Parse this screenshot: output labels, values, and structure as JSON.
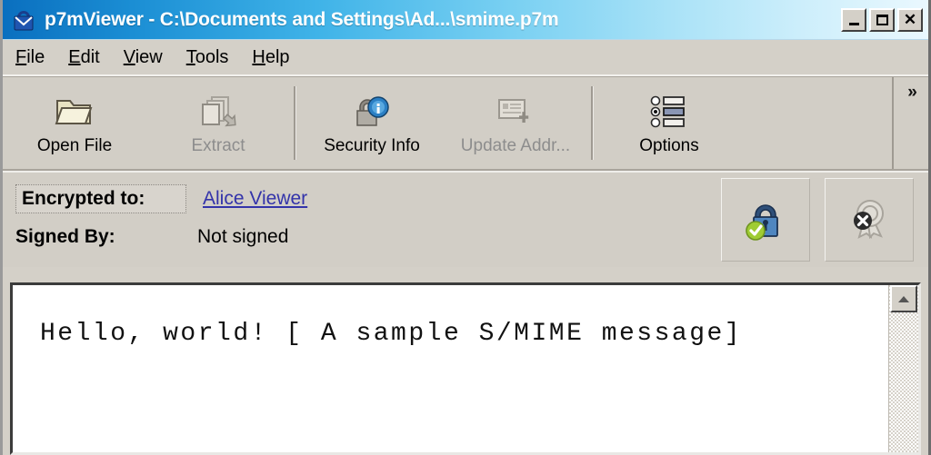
{
  "window": {
    "title": "p7mViewer - C:\\Documents and Settings\\Ad...\\smime.p7m",
    "app_icon": "envelope-lock-icon",
    "controls": {
      "minimize": "_",
      "maximize": "□",
      "close": "✕"
    }
  },
  "menu": {
    "items": [
      {
        "accel": "F",
        "rest": "ile"
      },
      {
        "accel": "E",
        "rest": "dit"
      },
      {
        "accel": "V",
        "rest": "iew"
      },
      {
        "accel": "T",
        "rest": "ools"
      },
      {
        "accel": "H",
        "rest": "elp"
      }
    ]
  },
  "toolbar": {
    "buttons": [
      {
        "label": "Open File",
        "icon": "open-folder-icon",
        "enabled": true
      },
      {
        "label": "Extract",
        "icon": "extract-pages-icon",
        "enabled": false
      },
      {
        "label": "Security Info",
        "icon": "lock-info-icon",
        "enabled": true
      },
      {
        "label": "Update Addr...",
        "icon": "address-card-plus-icon",
        "enabled": false
      },
      {
        "label": "Options",
        "icon": "options-list-icon",
        "enabled": true
      }
    ],
    "overflow_label": "»"
  },
  "info": {
    "encrypted_to_label": "Encrypted to:",
    "encrypted_to_value": "Alice Viewer",
    "signed_by_label": "Signed By:",
    "signed_by_value": "Not signed",
    "status_buttons": [
      {
        "icon": "padlock-valid-icon",
        "state": "encrypted-ok"
      },
      {
        "icon": "certificate-seal-x-icon",
        "state": "not-signed"
      }
    ]
  },
  "body": {
    "text": "Hello, world! [ A sample S/MIME message]"
  },
  "scrollbar": {
    "up_arrow": "▲"
  },
  "colors": {
    "title_bar_start": "#0a6fbf",
    "title_bar_end": "#eaf8fe",
    "face": "#d4d0c8",
    "link": "#3333aa",
    "disabled_text": "#8d8d8d"
  }
}
